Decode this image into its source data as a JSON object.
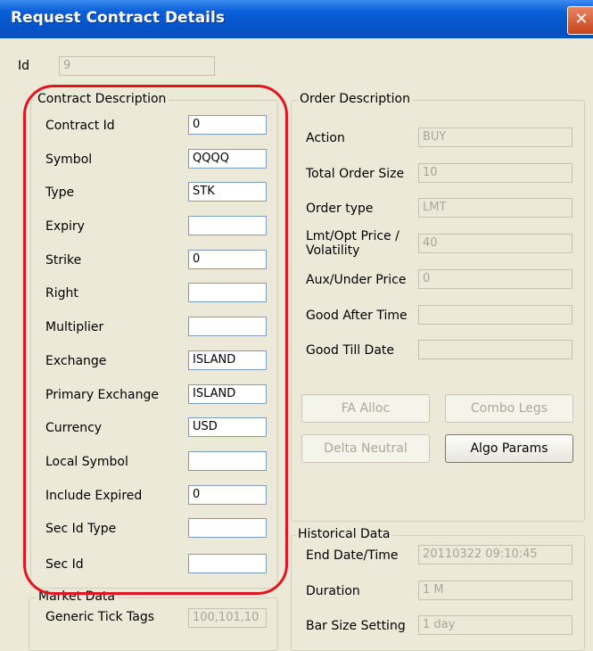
{
  "window": {
    "title": "Request Contract Details",
    "close_glyph": "✕"
  },
  "id_field": {
    "label": "Id",
    "value": "9"
  },
  "contract": {
    "title": "Contract Description",
    "fields": [
      {
        "label": "Contract Id",
        "value": "0"
      },
      {
        "label": "Symbol",
        "value": "QQQQ"
      },
      {
        "label": "Type",
        "value": "STK"
      },
      {
        "label": "Expiry",
        "value": ""
      },
      {
        "label": "Strike",
        "value": "0"
      },
      {
        "label": "Right",
        "value": ""
      },
      {
        "label": "Multiplier",
        "value": ""
      },
      {
        "label": "Exchange",
        "value": "ISLAND"
      },
      {
        "label": "Primary Exchange",
        "value": "ISLAND"
      },
      {
        "label": "Currency",
        "value": "USD"
      },
      {
        "label": "Local Symbol",
        "value": ""
      },
      {
        "label": "Include Expired",
        "value": "0"
      },
      {
        "label": "Sec Id Type",
        "value": ""
      },
      {
        "label": "Sec Id",
        "value": ""
      }
    ]
  },
  "order": {
    "title": "Order Description",
    "fields": [
      {
        "label": "Action",
        "value": "BUY"
      },
      {
        "label": "Total Order Size",
        "value": "10"
      },
      {
        "label": "Order type",
        "value": "LMT"
      },
      {
        "label": "Lmt/Opt Price / Volatility",
        "value": "40"
      },
      {
        "label": "Aux/Under Price",
        "value": "0"
      },
      {
        "label": "Good After Time",
        "value": ""
      },
      {
        "label": "Good Till Date",
        "value": ""
      }
    ],
    "buttons": {
      "fa_alloc": "FA Alloc",
      "combo_legs": "Combo Legs",
      "delta_neutral": "Delta Neutral",
      "algo_params": "Algo Params"
    }
  },
  "historical": {
    "title": "Historical Data",
    "fields": [
      {
        "label": "End Date/Time",
        "value": "20110322 09:10:45"
      },
      {
        "label": "Duration",
        "value": "1 M"
      },
      {
        "label": "Bar Size Setting",
        "value": "1 day"
      }
    ]
  },
  "market": {
    "title": "Market Data",
    "generic_tick_tags_label": "Generic Tick Tags",
    "generic_tick_tags_value": "100,101,10"
  },
  "colors": {
    "highlight": "#e3141d",
    "titlebar": "#0553c8",
    "window_bg": "#ece9d8"
  }
}
